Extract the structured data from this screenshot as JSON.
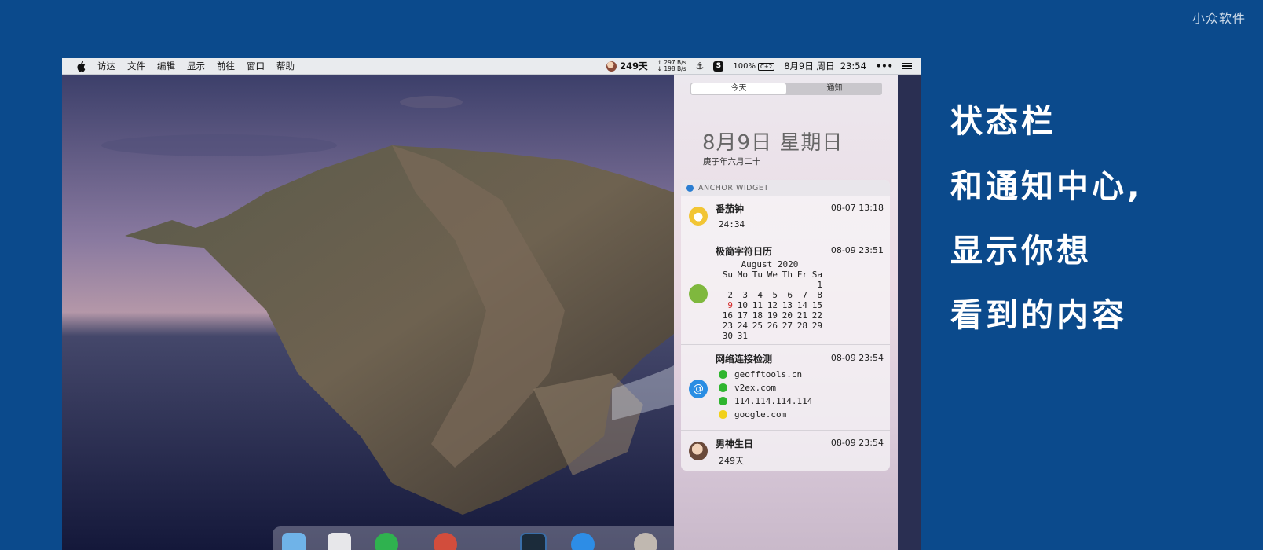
{
  "watermark": "小众软件",
  "menubar": {
    "app_menus": [
      "访达",
      "文件",
      "编辑",
      "显示",
      "前往",
      "窗口",
      "帮助"
    ],
    "days_counter": "249天",
    "net_up": "↑ 297 B/s",
    "net_down": "↓ 198 B/s",
    "battery": "100%",
    "battery_badge": "C+2",
    "clock": "8月9日 周日  23:54",
    "more": "•••"
  },
  "notification_center": {
    "tabs": [
      "今天",
      "通知"
    ],
    "active_tab": "今天",
    "date": "8月9日 星期日",
    "lunar_date": "庚子年六月二十"
  },
  "widget": {
    "title": "ANCHOR WIDGET",
    "items": [
      {
        "title": "番茄钟",
        "time": "08-07 13:18",
        "value": "24:34"
      },
      {
        "title": "极简字符日历",
        "time": "08-09 23:51",
        "calendar": {
          "month_label": "August 2020",
          "weekdays": [
            "Su",
            "Mo",
            "Tu",
            "We",
            "Th",
            "Fr",
            "Sa"
          ],
          "weeks": [
            [
              "",
              "",
              "",
              "",
              "",
              "",
              "1"
            ],
            [
              "2",
              "3",
              "4",
              "5",
              "6",
              "7",
              "8"
            ],
            [
              "9",
              "10",
              "11",
              "12",
              "13",
              "14",
              "15"
            ],
            [
              "16",
              "17",
              "18",
              "19",
              "20",
              "21",
              "22"
            ],
            [
              "23",
              "24",
              "25",
              "26",
              "27",
              "28",
              "29"
            ],
            [
              "30",
              "31",
              "",
              "",
              "",
              "",
              ""
            ]
          ],
          "today": "9"
        }
      },
      {
        "title": "网络连接检测",
        "time": "08-09 23:54",
        "hosts": [
          {
            "name": "geofftools.cn",
            "status": "green"
          },
          {
            "name": "v2ex.com",
            "status": "green"
          },
          {
            "name": "114.114.114.114",
            "status": "green"
          },
          {
            "name": "google.com",
            "status": "yellow"
          }
        ]
      },
      {
        "title": "男神生日",
        "time": "08-09 23:54",
        "value": "249天"
      }
    ]
  },
  "caption_lines": [
    "状态栏",
    "和通知中心,",
    "显示你想",
    "看到的内容"
  ],
  "colors": {
    "background": "#0b4a8c",
    "green_status": "#2fb52f",
    "yellow_status": "#f1d11a",
    "today_red": "#d42a2a"
  }
}
